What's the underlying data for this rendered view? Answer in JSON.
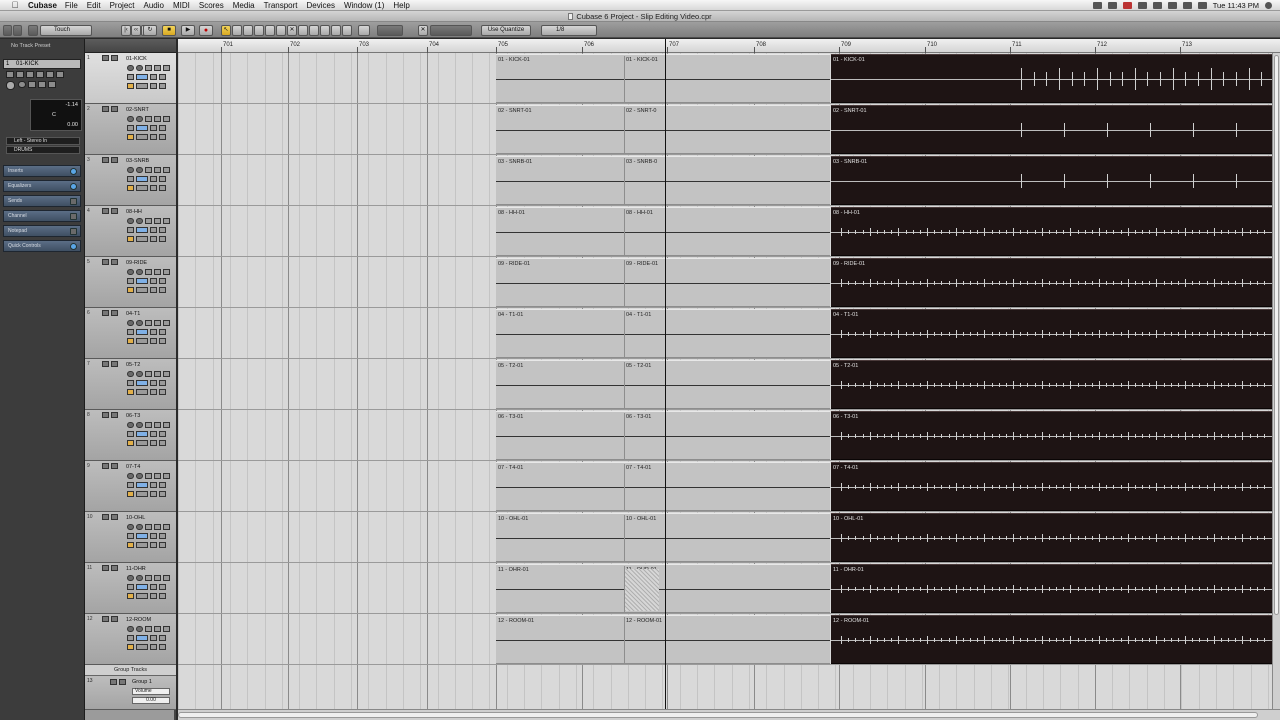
{
  "menubar": {
    "app_name": "Cubase",
    "items": [
      "File",
      "Edit",
      "Project",
      "Audio",
      "MIDI",
      "Scores",
      "Media",
      "Transport",
      "Devices",
      "Window (1)",
      "Help"
    ],
    "clock": "Tue 11:43 PM"
  },
  "window": {
    "title": "Cubase 6 Project - Slip Editing Video.cpr"
  },
  "toolbar": {
    "automation_mode": "Touch",
    "quantize_mode": "Use Quantize",
    "quantize_value": "1/8"
  },
  "inspector": {
    "track_preset": "No Track Preset",
    "track_number": "1",
    "track_name": "01-KICK",
    "volume_value": "-1.14",
    "pan_label": "C",
    "delay_value": "0.00",
    "input_routing": "Left - Stereo In",
    "output_routing": "DRUMS",
    "sections": [
      {
        "label": "Inserts",
        "icon": "power-icon",
        "active": true
      },
      {
        "label": "Equalizers",
        "icon": "power-icon",
        "active": true
      },
      {
        "label": "Sends",
        "icon": "bypass-icon",
        "active": false
      },
      {
        "label": "Channel",
        "icon": "bypass-icon",
        "active": false
      },
      {
        "label": "Notepad",
        "icon": "bypass-icon",
        "active": false
      },
      {
        "label": "Quick Controls",
        "icon": "power-icon",
        "active": true
      }
    ]
  },
  "tracks": [
    {
      "num": "1",
      "name": "01-KICK",
      "selected": true
    },
    {
      "num": "2",
      "name": "02-SNRT",
      "selected": false
    },
    {
      "num": "3",
      "name": "03-SNRB",
      "selected": false
    },
    {
      "num": "4",
      "name": "08-HH",
      "selected": false
    },
    {
      "num": "5",
      "name": "09-RIDE",
      "selected": false
    },
    {
      "num": "6",
      "name": "04-T1",
      "selected": false
    },
    {
      "num": "7",
      "name": "05-T2",
      "selected": false
    },
    {
      "num": "8",
      "name": "06-T3",
      "selected": false
    },
    {
      "num": "9",
      "name": "07-T4",
      "selected": false
    },
    {
      "num": "10",
      "name": "10-OHL",
      "selected": false
    },
    {
      "num": "11",
      "name": "11-OHR",
      "selected": false
    },
    {
      "num": "12",
      "name": "12-ROOM",
      "selected": false
    }
  ],
  "group": {
    "folder_label": "Group Tracks",
    "num": "13",
    "name": "Group 1",
    "param": "Volume",
    "value": "0.00"
  },
  "ruler": {
    "bars": [
      "701",
      "702",
      "703",
      "704",
      "705",
      "706",
      "707",
      "708",
      "709",
      "710",
      "711",
      "712",
      "713"
    ]
  },
  "events": [
    {
      "left": "01 - KICK-01",
      "mid": "01 - KICK-01",
      "right": "01 - KICK-01"
    },
    {
      "left": "02 - SNRT-01",
      "mid": "02 - SNRT-0",
      "right": "02 - SNRT-01"
    },
    {
      "left": "03 - SNRB-01",
      "mid": "03 - SNRB-0",
      "right": "03 - SNRB-01"
    },
    {
      "left": "08 - HH-01",
      "mid": "08 - HH-01",
      "right": "08 - HH-01"
    },
    {
      "left": "09 - RIDE-01",
      "mid": "09 - RIDE-01",
      "right": "09 - RIDE-01"
    },
    {
      "left": "04 - T1-01",
      "mid": "04 - T1-01",
      "right": "04 - T1-01"
    },
    {
      "left": "05 - T2-01",
      "mid": "05 - T2-01",
      "right": "05 - T2-01"
    },
    {
      "left": "06 - T3-01",
      "mid": "06 - T3-01",
      "right": "06 - T3-01"
    },
    {
      "left": "07 - T4-01",
      "mid": "07 - T4-01",
      "right": "07 - T4-01"
    },
    {
      "left": "10 - OHL-01",
      "mid": "10 - OHL-01",
      "right": "10 - OHL-01"
    },
    {
      "left": "11 - OHR-01",
      "mid": "11 - OHR-01",
      "right": "11 - OHR-01"
    },
    {
      "left": "12 - ROOM-01",
      "mid": "12 - ROOM-01",
      "right": "12 - ROOM-01"
    }
  ],
  "colors": {
    "event_gray": "#c3c3c3",
    "event_dark": "#1e1414",
    "inspector_section": "#4d5f76",
    "record": "#c00000",
    "selected_tool": "#e8c23c"
  }
}
